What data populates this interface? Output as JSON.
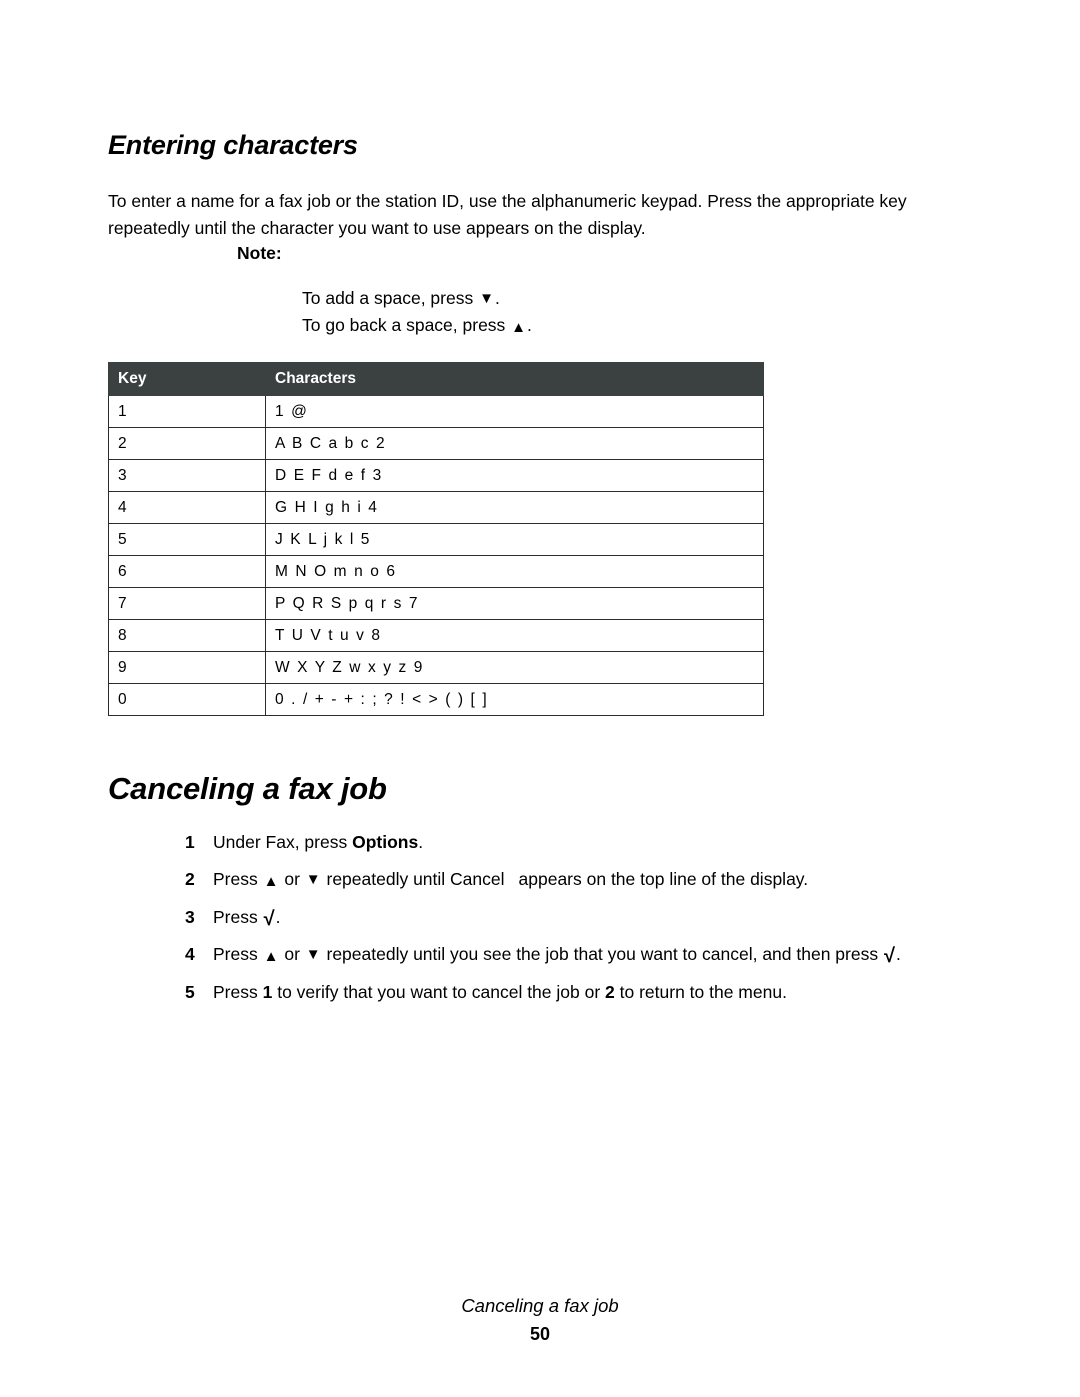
{
  "document": {
    "section_heading": "Entering characters",
    "intro_paragraph": "To enter a name for a fax job or the station ID, use the alphanumeric keypad. Press the appropriate key repeatedly until the character you want to use appears on the display.",
    "note": {
      "label": "Note:",
      "line1_before": "To add a space, press ",
      "line1_icon": "▼",
      "line1_after": ".",
      "line2_before": "To go back a space, press ",
      "line2_icon": "▲",
      "line2_after": "."
    },
    "character_table": {
      "header_key": "Key",
      "header_characters": "Characters",
      "header_background": "#3a4140",
      "header_text_color": "#ffffff",
      "rows": [
        {
          "key": "1",
          "characters": "1 @"
        },
        {
          "key": "2",
          "characters": "A B C a b c 2"
        },
        {
          "key": "3",
          "characters": "D E F d e f 3"
        },
        {
          "key": "4",
          "characters": "G H I g h i 4"
        },
        {
          "key": "5",
          "characters": "J K L j k l 5"
        },
        {
          "key": "6",
          "characters": "M N O m n o 6"
        },
        {
          "key": "7",
          "characters": "P Q R S p q r s 7"
        },
        {
          "key": "8",
          "characters": "T U V t u v 8"
        },
        {
          "key": "9",
          "characters": "W X Y Z w x y z 9"
        },
        {
          "key": "0",
          "characters": "0 . / + - + : ; ? ! < > ( ) [ ]"
        }
      ]
    }
  },
  "canceling": {
    "heading": "Canceling a fax job",
    "steps": [
      {
        "number": "1",
        "parts": [
          {
            "t": "Under Fax, press ",
            "style": "normal"
          },
          {
            "t": "Options",
            "style": "bold"
          },
          {
            "t": ".",
            "style": "normal"
          }
        ]
      },
      {
        "number": "2",
        "parts": [
          {
            "t": "Press ",
            "style": "normal"
          },
          {
            "t": "▲",
            "style": "icon-up"
          },
          {
            "t": " or ",
            "style": "normal"
          },
          {
            "t": "▼",
            "style": "icon-down"
          },
          {
            "t": " repeatedly until Cancel",
            "style": "normal"
          },
          {
            "t": " ",
            "style": "gap"
          },
          {
            "t": "appears on the top line of the display.",
            "style": "normal"
          }
        ]
      },
      {
        "number": "3",
        "parts": [
          {
            "t": "Press ",
            "style": "normal"
          },
          {
            "t": "√",
            "style": "icon-check"
          },
          {
            "t": ".",
            "style": "normal"
          }
        ]
      },
      {
        "number": "4",
        "parts": [
          {
            "t": "Press ",
            "style": "normal"
          },
          {
            "t": "▲",
            "style": "icon-up"
          },
          {
            "t": " or ",
            "style": "normal"
          },
          {
            "t": "▼",
            "style": "icon-down"
          },
          {
            "t": " repeatedly until you see the job that you want to cancel, and then press ",
            "style": "normal"
          },
          {
            "t": "√",
            "style": "icon-check"
          },
          {
            "t": ".",
            "style": "normal"
          }
        ]
      },
      {
        "number": "5",
        "parts": [
          {
            "t": "Press ",
            "style": "normal"
          },
          {
            "t": "1",
            "style": "bold"
          },
          {
            "t": " to verify that you want to cancel the job or ",
            "style": "normal"
          },
          {
            "t": "2",
            "style": "bold"
          },
          {
            "t": " to return to the menu.",
            "style": "normal"
          }
        ]
      }
    ]
  },
  "footer": {
    "title": "Canceling a fax job",
    "page_number": "50"
  }
}
